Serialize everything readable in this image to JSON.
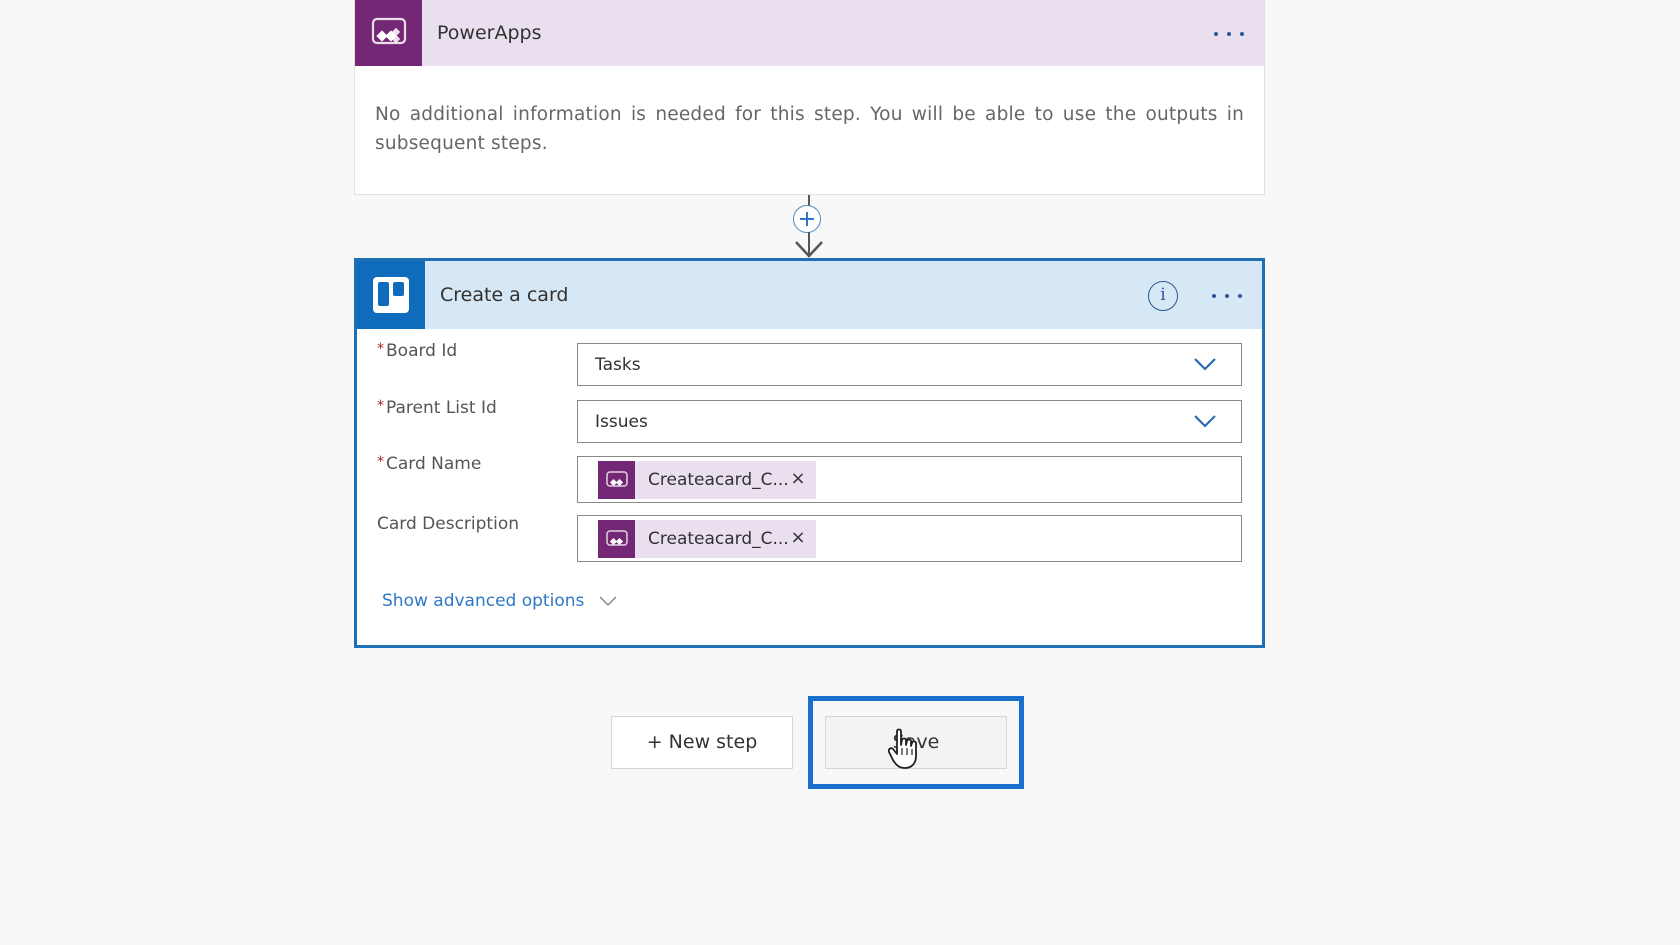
{
  "trigger_card": {
    "title": "PowerApps",
    "icon": "powerapps-icon",
    "more_icon": "more-options-icon",
    "description": "No additional information is needed for this step. You will be able to use the outputs in subsequent steps.",
    "header_color": "#e9dfee",
    "brand_color": "#742774"
  },
  "connector": {
    "icon": "add-step-plus-icon",
    "arrow": "down-arrow-icon"
  },
  "action_card": {
    "title": "Create a card",
    "icon": "trello-icon",
    "info_icon": "info-icon",
    "info_glyph": "i",
    "more_icon": "more-options-icon",
    "header_color": "#d6e7f5",
    "brand_color": "#0f6cbd",
    "required_marker": "*",
    "fields": [
      {
        "label": "Board Id",
        "required": true,
        "type": "dropdown",
        "value": "Tasks"
      },
      {
        "label": "Parent List Id",
        "required": true,
        "type": "dropdown",
        "value": "Issues"
      },
      {
        "label": "Card Name",
        "required": true,
        "type": "token",
        "token_text": "Createacard_C...",
        "token_close": "×"
      },
      {
        "label": "Card Description",
        "required": false,
        "type": "token",
        "token_text": "Createacard_C...",
        "token_close": "×"
      }
    ],
    "advanced_link": "Show advanced options"
  },
  "buttons": {
    "new_step": "+ New step",
    "save": "Save"
  },
  "highlight_color": "#1a6fcf"
}
